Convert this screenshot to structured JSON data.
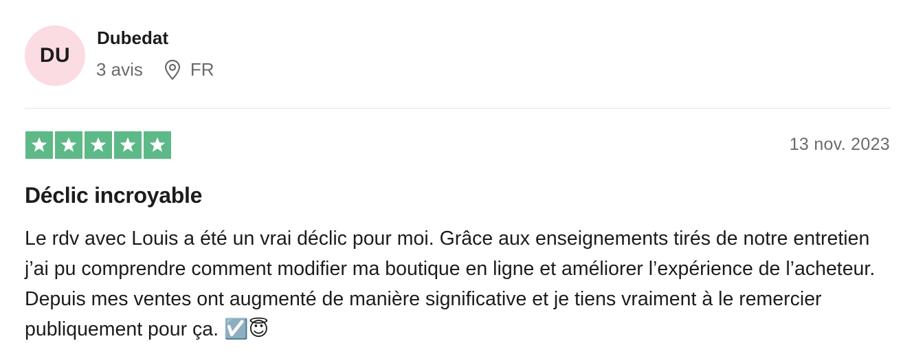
{
  "reviewer": {
    "initials": "DU",
    "name": "Dubedat",
    "review_count": "3 avis",
    "country": "FR",
    "avatar_color": "#fadce2"
  },
  "review": {
    "rating": 5,
    "rating_max": 5,
    "star_color": "#5db987",
    "date": "13 nov. 2023",
    "title": "Déclic incroyable",
    "body": "Le rdv avec Louis a été un vrai déclic pour moi. Grâce aux enseignements tirés de notre entretien j’ai pu comprendre comment modifier ma boutique en ligne et améliorer l’expérience de l’acheteur. Depuis mes ventes ont augmenté de manière significative et je tiens vraiment à le remercier publiquement pour ça.",
    "emojis": "☑️😇"
  },
  "icons": {
    "location": "location-pin-icon",
    "star": "star-icon"
  }
}
